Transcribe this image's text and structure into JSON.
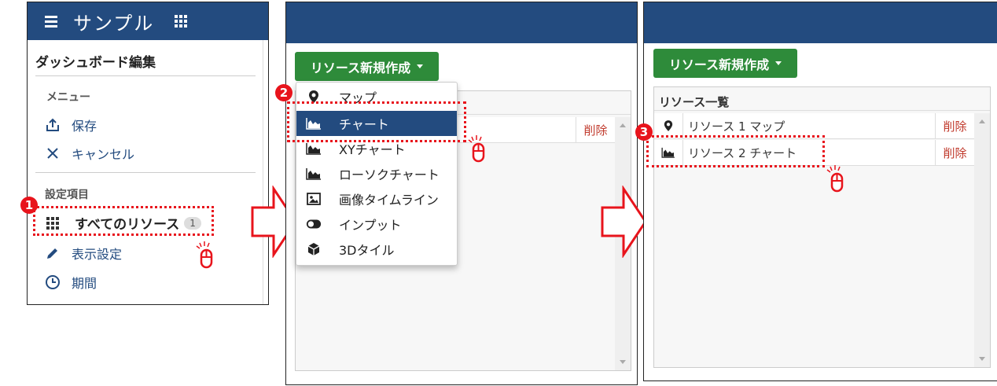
{
  "panel1": {
    "app_title": "サンプル",
    "dashboard_edit": "ダッシュボード編集",
    "menu_label": "メニュー",
    "save": "保存",
    "cancel": "キャンセル",
    "settings_label": "設定項目",
    "all_resources": "すべてのリソース",
    "all_resources_count": "1",
    "display_settings": "表示設定",
    "period": "期間"
  },
  "panel2": {
    "create_button": "リソース新規作成",
    "delete": "削除",
    "dropdown": [
      {
        "label": "マップ",
        "icon": "map-pin-icon"
      },
      {
        "label": "チャート",
        "icon": "area-chart-icon",
        "selected": true
      },
      {
        "label": "XYチャート",
        "icon": "area-chart-icon"
      },
      {
        "label": "ローソクチャート",
        "icon": "area-chart-icon"
      },
      {
        "label": "画像タイムライン",
        "icon": "image-icon"
      },
      {
        "label": "インプット",
        "icon": "toggle-icon"
      },
      {
        "label": "3Dタイル",
        "icon": "cube-icon"
      }
    ]
  },
  "panel3": {
    "create_button": "リソース新規作成",
    "list_title": "リソース一覧",
    "rows": [
      {
        "name": "リソース 1 マップ",
        "icon": "map-pin-icon",
        "delete": "削除"
      },
      {
        "name": "リソース 2 チャート",
        "icon": "area-chart-icon",
        "delete": "削除"
      }
    ]
  },
  "annotations": {
    "step1": "1",
    "step2": "2",
    "step3": "3",
    "highlight_color": "#e8141c"
  },
  "colors": {
    "navy": "#234b7f",
    "green": "#2e8b3a",
    "danger": "#c0392b"
  }
}
